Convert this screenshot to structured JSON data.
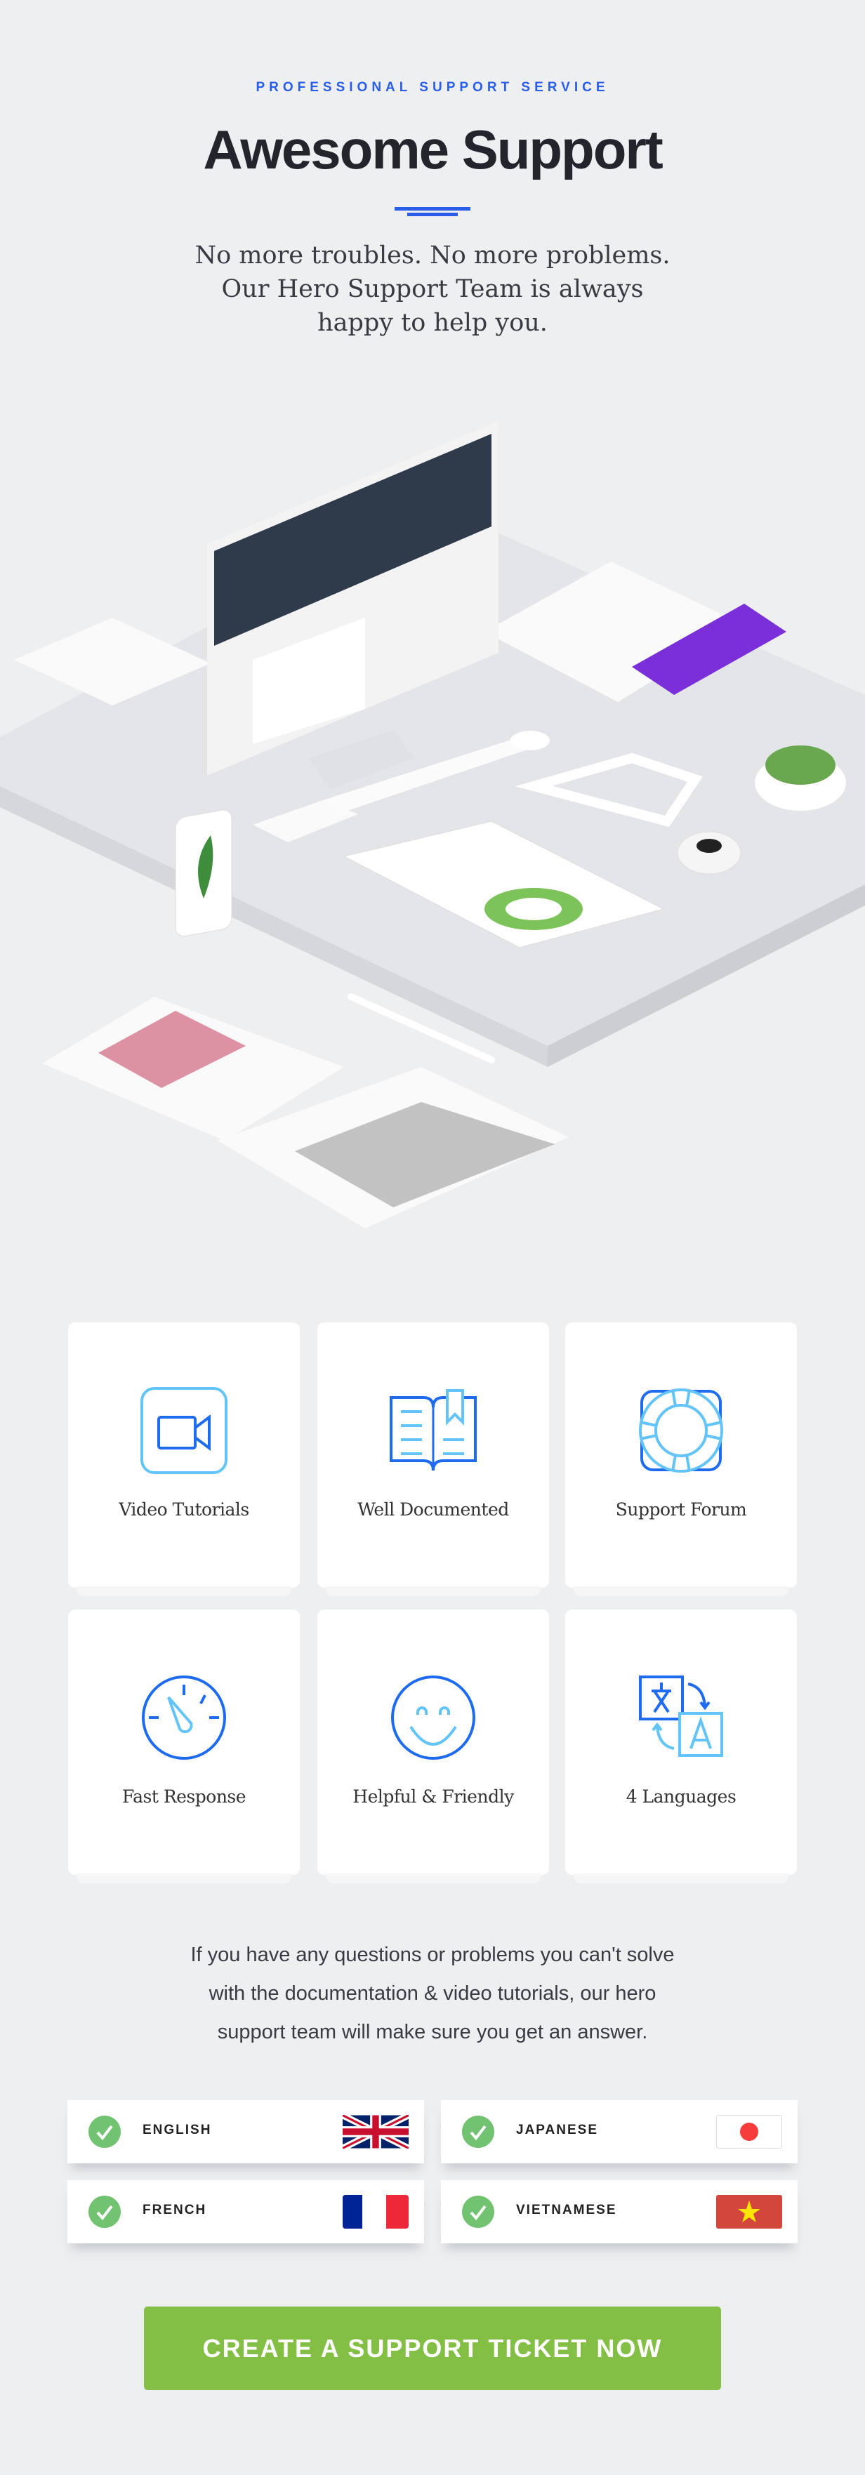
{
  "header": {
    "eyebrow": "PROFESSIONAL SUPPORT SERVICE",
    "title": "Awesome Support",
    "subtitle_lines": [
      "No more troubles. No more problems.",
      "Our Hero Support Team is always",
      "happy to help you."
    ]
  },
  "colors": {
    "accent": "#2a5de8",
    "icon_dark": "#1e6bf0",
    "icon_light": "#62c4f8",
    "check": "#72c371",
    "cta": "#84bf45",
    "background": "#eeeff1"
  },
  "features": [
    {
      "label": "Video Tutorials",
      "icon": "video-camera-icon"
    },
    {
      "label": "Well Documented",
      "icon": "open-book-icon"
    },
    {
      "label": "Support Forum",
      "icon": "lifebuoy-icon"
    },
    {
      "label": "Fast Response",
      "icon": "speedometer-icon"
    },
    {
      "label": "Helpful & Friendly",
      "icon": "smiley-icon"
    },
    {
      "label": "4 Languages",
      "icon": "translate-icon"
    }
  ],
  "info_lines": [
    "If you have any questions or problems you can't solve",
    "with the documentation & video tutorials, our hero",
    "support team will make sure you get an answer."
  ],
  "languages": [
    {
      "name": "ENGLISH",
      "flag": "uk-flag-icon"
    },
    {
      "name": "JAPANESE",
      "flag": "japan-flag-icon"
    },
    {
      "name": "FRENCH",
      "flag": "france-flag-icon"
    },
    {
      "name": "VIETNAMESE",
      "flag": "vietnam-flag-icon"
    }
  ],
  "cta": {
    "label": "CREATE A SUPPORT TICKET NOW"
  }
}
